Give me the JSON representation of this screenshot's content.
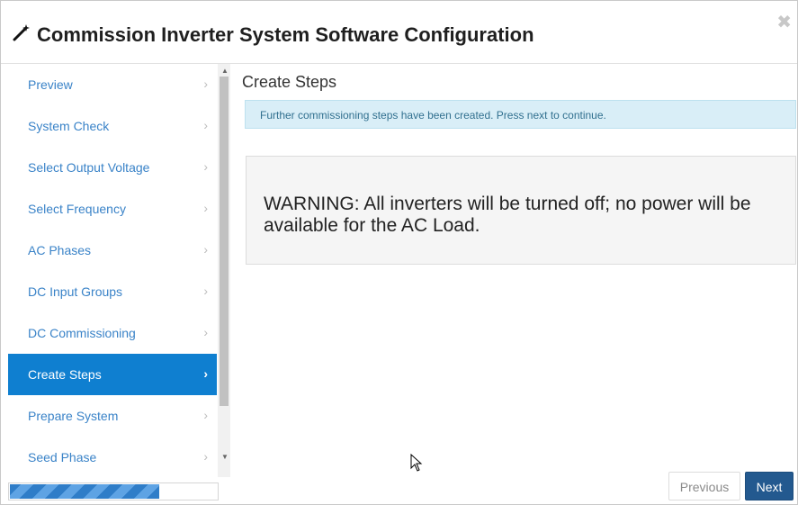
{
  "dialog": {
    "title": "Commission Inverter System Software Configuration",
    "close_glyph": "✖"
  },
  "sidebar": {
    "items": [
      {
        "label": "Preview",
        "active": false
      },
      {
        "label": "System Check",
        "active": false
      },
      {
        "label": "Select Output Voltage",
        "active": false
      },
      {
        "label": "Select Frequency",
        "active": false
      },
      {
        "label": "AC Phases",
        "active": false
      },
      {
        "label": "DC Input Groups",
        "active": false
      },
      {
        "label": "DC Commissioning",
        "active": false
      },
      {
        "label": "Create Steps",
        "active": true
      },
      {
        "label": "Prepare System",
        "active": false
      },
      {
        "label": "Seed Phase",
        "active": false
      }
    ],
    "chevron_glyph": "›",
    "progress_fraction": 0.72
  },
  "main": {
    "title": "Create Steps",
    "info": "Further commissioning steps have been created. Press next to continue.",
    "warning": "WARNING: All inverters will be turned off; no power will be available for the AC Load."
  },
  "footer": {
    "previous_label": "Previous",
    "next_label": "Next"
  },
  "colors": {
    "active_bg": "#0f7fd0",
    "link": "#3a83c8",
    "next_bg": "#23598f",
    "info_bg": "#d9eef7"
  },
  "icons": {
    "header": "magic-wand-icon",
    "close": "close-icon",
    "nav": "chevron-right-icon"
  }
}
